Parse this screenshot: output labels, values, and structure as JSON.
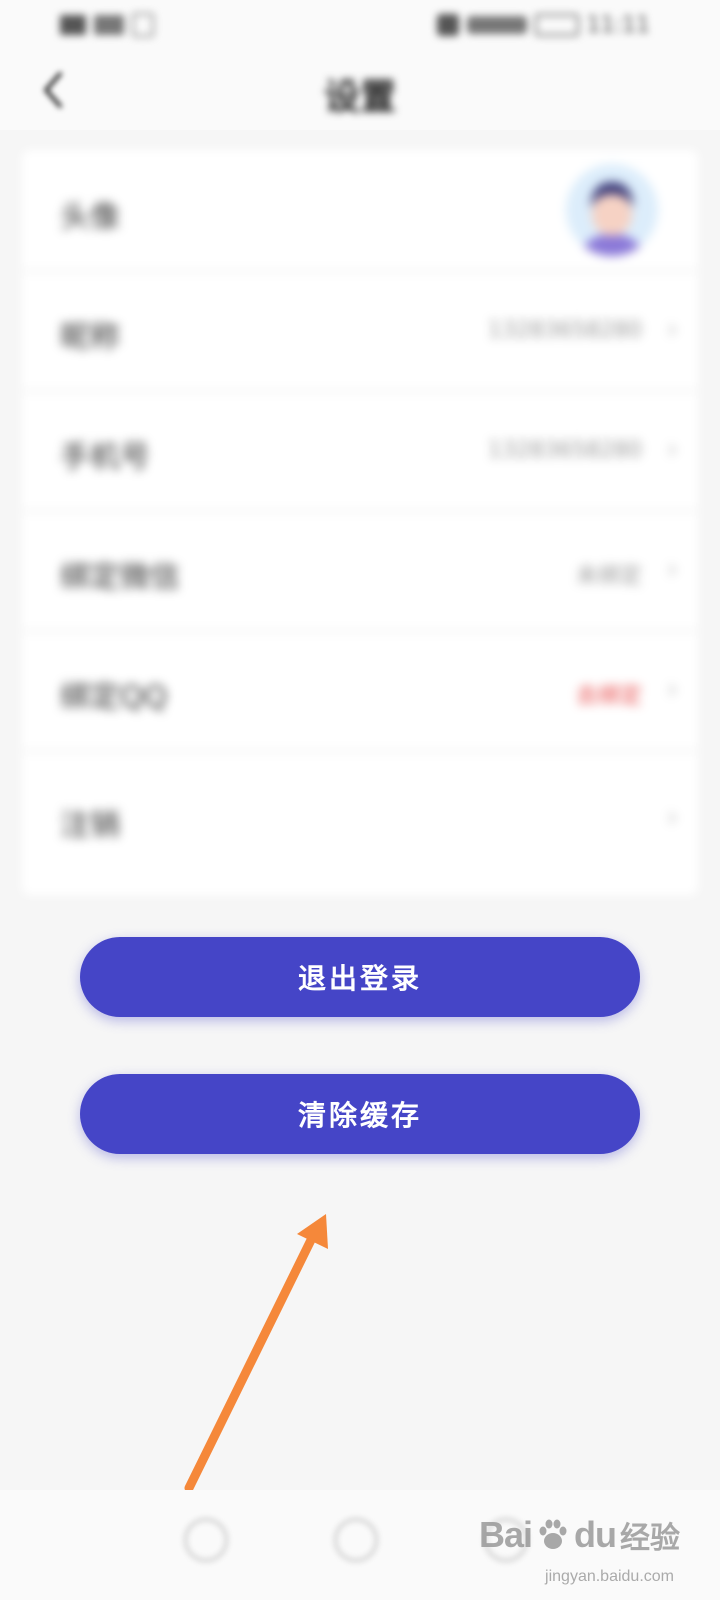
{
  "status_bar": {
    "time": "11:11"
  },
  "header": {
    "title": "设置"
  },
  "settings": {
    "rows": [
      {
        "label": "头像",
        "value": ""
      },
      {
        "label": "昵称",
        "value": "13283658280"
      },
      {
        "label": "手机号",
        "value": "13283658280"
      },
      {
        "label": "绑定微信",
        "value": "未绑定"
      },
      {
        "label": "绑定QQ",
        "value": "去绑定"
      },
      {
        "label": "注销",
        "value": ""
      }
    ]
  },
  "actions": {
    "logout_label": "退出登录",
    "clear_cache_label": "清除缓存"
  },
  "watermark": {
    "brand": "Bai",
    "brand2": "du",
    "jingyan": "经验",
    "url": "jingyan.baidu.com"
  },
  "colors": {
    "primary": "#4545c7",
    "arrow": "#f5883a",
    "warn": "#e74b4b"
  }
}
